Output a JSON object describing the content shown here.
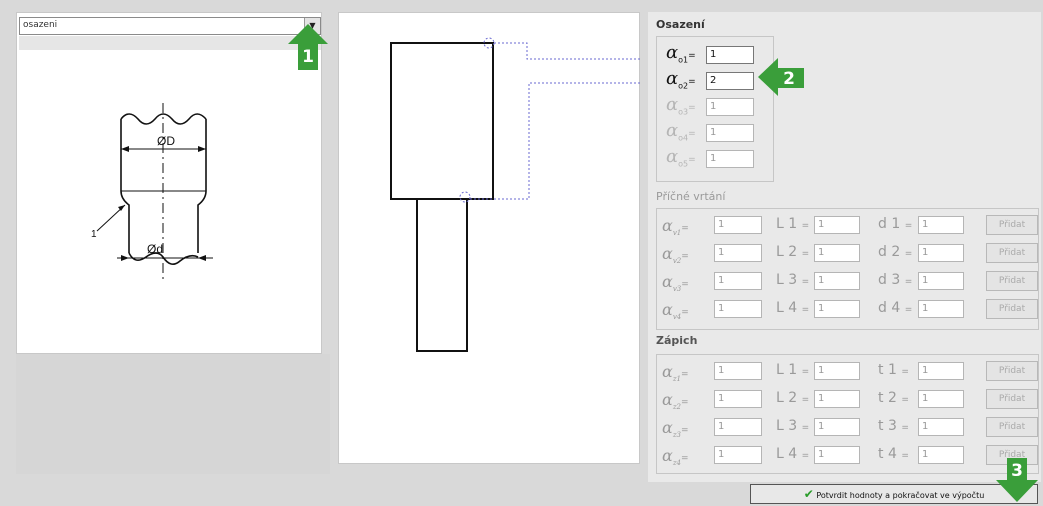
{
  "combo": {
    "value": "osazeni"
  },
  "drawing": {
    "dim_big": "ØD",
    "dim_small": "Ød",
    "leader_mark": "1"
  },
  "sections": {
    "osazeni": "Osazení",
    "pricne": "Příčné vrtání",
    "zapich": "Zápich"
  },
  "osazeni_rows": [
    {
      "sym": "α",
      "sub": "o1",
      "eq": "=",
      "value": "1"
    },
    {
      "sym": "α",
      "sub": "o2",
      "eq": "=",
      "value": "2"
    },
    {
      "sym": "α",
      "sub": "o3",
      "eq": "=",
      "value": "1"
    },
    {
      "sym": "α",
      "sub": "o4",
      "eq": "=",
      "value": "1"
    },
    {
      "sym": "α",
      "sub": "o5",
      "eq": "=",
      "value": "1"
    }
  ],
  "pricne_rows": [
    {
      "a": "v1",
      "a_val": "1",
      "l": "L 1",
      "l_val": "1",
      "d": "d 1",
      "d_val": "1",
      "btn": "Přidat"
    },
    {
      "a": "v2",
      "a_val": "1",
      "l": "L 2",
      "l_val": "1",
      "d": "d 2",
      "d_val": "1",
      "btn": "Přidat"
    },
    {
      "a": "v3",
      "a_val": "1",
      "l": "L 3",
      "l_val": "1",
      "d": "d 3",
      "d_val": "1",
      "btn": "Přidat"
    },
    {
      "a": "v4",
      "a_val": "1",
      "l": "L 4",
      "l_val": "1",
      "d": "d 4",
      "d_val": "1",
      "btn": "Přidat"
    }
  ],
  "zapich_rows": [
    {
      "a": "z1",
      "a_val": "1",
      "l": "L 1",
      "l_val": "1",
      "t": "t 1",
      "t_val": "1",
      "btn": "Přidat"
    },
    {
      "a": "z2",
      "a_val": "1",
      "l": "L 2",
      "l_val": "1",
      "t": "t 2",
      "t_val": "1",
      "btn": "Přidat"
    },
    {
      "a": "z3",
      "a_val": "1",
      "l": "L 3",
      "l_val": "1",
      "t": "t 3",
      "t_val": "1",
      "btn": "Přidat"
    },
    {
      "a": "z4",
      "a_val": "1",
      "l": "L 4",
      "l_val": "1",
      "t": "t 4",
      "t_val": "1",
      "btn": "Přidat"
    }
  ],
  "confirm_label": "Potvrdit hodnoty a pokračovat ve výpočtu",
  "badges": [
    "1",
    "2",
    "3"
  ],
  "colors": {
    "badge_green": "#3a9e3a"
  }
}
